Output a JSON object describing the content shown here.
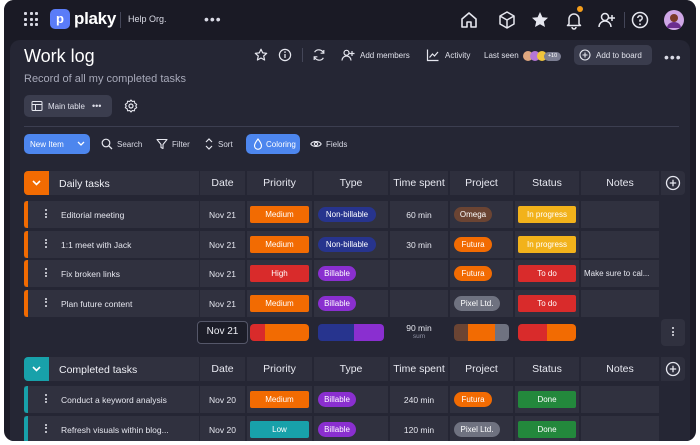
{
  "app": {
    "brand": "plaky",
    "org": "Help Org.",
    "more": "•••"
  },
  "board": {
    "title": "Work log",
    "subtitle": "Record of all my completed tasks",
    "add_members": "Add members",
    "activity": "Activity",
    "last_seen": "Last seen",
    "last_seen_more": "+10",
    "add_to_board": "Add to board",
    "main_table": "Main table",
    "more": "•••"
  },
  "toolbar": {
    "new_item": "New Item",
    "search": "Search",
    "filter": "Filter",
    "sort": "Sort",
    "coloring": "Coloring",
    "fields": "Fields"
  },
  "columns": [
    "Date",
    "Priority",
    "Type",
    "Time spent",
    "Project",
    "Status",
    "Notes"
  ],
  "colors": {
    "orange": "#f26b02",
    "red": "#d92b2b",
    "navy": "#27348e",
    "purple": "#8a2fd0",
    "brown": "#6b4433",
    "gray": "#6f7280",
    "yellow": "#f2b21b",
    "green": "#23883c",
    "teal": "#18a1aa"
  },
  "groups": [
    {
      "name": "Daily tasks",
      "color": "#f26b02",
      "rows": [
        {
          "name": "Editorial meeting",
          "date": "Nov 21",
          "priority": "Medium",
          "priority_color": "#f26b02",
          "type": "Non-billable",
          "type_color": "#27348e",
          "time": "60 min",
          "project": "Omega",
          "project_color": "#6b4433",
          "status": "In progress",
          "status_color": "#f2b21b",
          "notes": ""
        },
        {
          "name": "1:1 meet with Jack",
          "date": "Nov 21",
          "priority": "Medium",
          "priority_color": "#f26b02",
          "type": "Non-billable",
          "type_color": "#27348e",
          "time": "30 min",
          "project": "Futura",
          "project_color": "#f26b02",
          "status": "In progress",
          "status_color": "#f2b21b",
          "notes": ""
        },
        {
          "name": "Fix broken links",
          "date": "Nov 21",
          "priority": "High",
          "priority_color": "#d92b2b",
          "type": "Billable",
          "type_color": "#8a2fd0",
          "time": "",
          "project": "Futura",
          "project_color": "#f26b02",
          "status": "To do",
          "status_color": "#d92b2b",
          "notes": "Make sure to cal..."
        },
        {
          "name": "Plan future content",
          "date": "Nov 21",
          "priority": "Medium",
          "priority_color": "#f26b02",
          "type": "Billable",
          "type_color": "#8a2fd0",
          "time": "",
          "project": "Pixel Ltd.",
          "project_color": "#6f7280",
          "status": "To do",
          "status_color": "#d92b2b",
          "notes": ""
        }
      ],
      "summary": {
        "date": "Nov 21",
        "time": "90 min",
        "time_label": "sum"
      }
    },
    {
      "name": "Completed tasks",
      "color": "#18a1aa",
      "rows": [
        {
          "name": "Conduct a keyword analysis",
          "date": "Nov 20",
          "priority": "Medium",
          "priority_color": "#f26b02",
          "type": "Billable",
          "type_color": "#8a2fd0",
          "time": "240 min",
          "project": "Futura",
          "project_color": "#f26b02",
          "status": "Done",
          "status_color": "#23883c",
          "notes": ""
        },
        {
          "name": "Refresh visuals within blog...",
          "date": "Nov 20",
          "priority": "Low",
          "priority_color": "#18a1aa",
          "type": "Billable",
          "type_color": "#8a2fd0",
          "time": "120 min",
          "project": "Pixel Ltd.",
          "project_color": "#6f7280",
          "status": "Done",
          "status_color": "#23883c",
          "notes": ""
        }
      ]
    }
  ]
}
